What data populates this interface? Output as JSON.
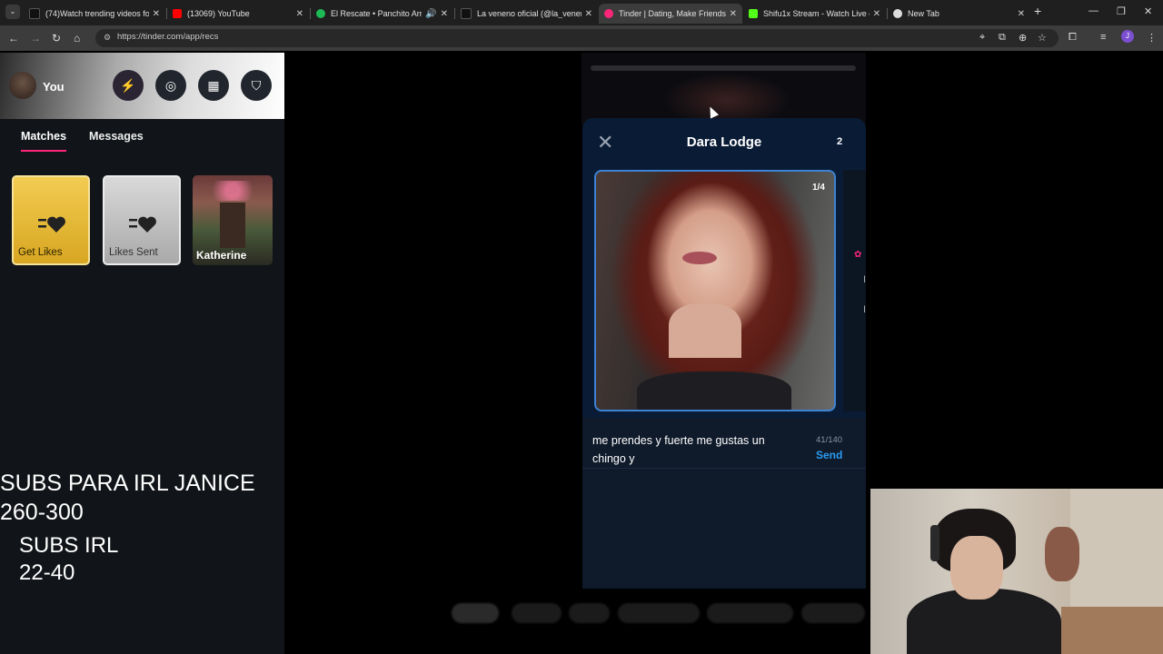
{
  "browser": {
    "tabs": [
      {
        "title": "(74)Watch trending videos for y",
        "icon": "tiktok-icon",
        "color": "#000000"
      },
      {
        "title": "(13069) YouTube",
        "icon": "youtube-icon",
        "color": "#ff0000"
      },
      {
        "title": "El Rescate • Panchito Arred",
        "icon": "spotify-icon",
        "color": "#1db954"
      },
      {
        "title": "La veneno oficial (@la_venenit",
        "icon": "tiktok-icon",
        "color": "#000000"
      },
      {
        "title": "Tinder | Dating, Make Friends &",
        "icon": "tinder-icon",
        "color": "#fd267a"
      },
      {
        "title": "Shifu1x Stream - Watch Live on",
        "icon": "kick-icon",
        "color": "#53fc18"
      },
      {
        "title": "New Tab",
        "icon": "chrome-icon",
        "color": "#cccccc"
      }
    ],
    "active_tab": 4,
    "url": "https://tinder.com/app/recs",
    "profile_initial": "J"
  },
  "sidebar": {
    "user_label": "You",
    "tabs": [
      "Matches",
      "Messages"
    ],
    "cards": {
      "get_likes": "Get Likes",
      "likes_sent": "Likes Sent",
      "match_name": "Katherine"
    }
  },
  "overlay": {
    "line1": "SUBS PARA IRL JANICE",
    "line2": "260-300",
    "line3": "SUBS IRL",
    "line4": "22-40"
  },
  "profile_panel": {
    "name": "Dara Lodge",
    "count": "2",
    "photo_index": "1/4",
    "message": "me prendes y fuerte me gustas un chingo y",
    "char_count": "41/140",
    "send_label": "Send"
  }
}
